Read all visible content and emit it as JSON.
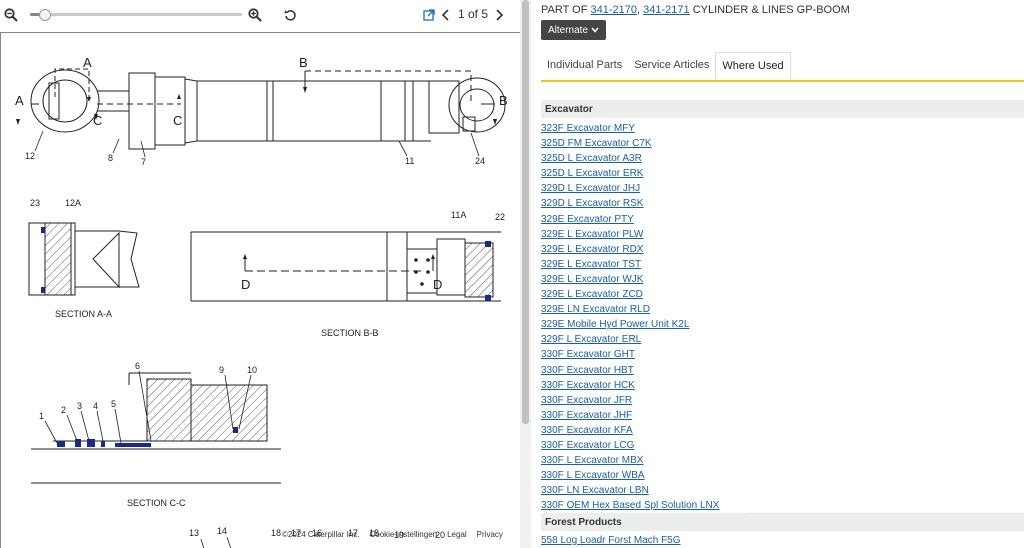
{
  "viewer": {
    "page_indicator": "1 of 5"
  },
  "drawing": {
    "labels": {
      "a": "A",
      "b": "B",
      "c": "C",
      "d": "D",
      "n12": "12",
      "n8": "8",
      "n7": "7",
      "n11": "11",
      "n24": "24",
      "n23": "23",
      "n12a": "12A",
      "n11a": "11A",
      "n22": "22",
      "n6": "6",
      "n9": "9",
      "n10": "10",
      "n1": "1",
      "n2": "2",
      "n3": "3",
      "n4": "4",
      "n5": "5",
      "n13": "13",
      "n14": "14",
      "n18": "18",
      "n17": "17",
      "n16": "16",
      "n19": "19",
      "n20": "20"
    },
    "section_aa": "SECTION A-A",
    "section_bb": "SECTION B-B",
    "section_cc": "SECTION C-C"
  },
  "footer": {
    "copyright": "©2024 Caterpillar Inc.",
    "cookie": "Cookie-instellingen",
    "legal": "Legal",
    "privacy": "Privacy"
  },
  "part_info": {
    "prefix": "PART OF",
    "link1": "341-2170",
    "sep": ",",
    "link2": "341-2171",
    "suffix": "CYLINDER & LINES GP-BOOM"
  },
  "alternate_button": "Alternate",
  "tabs": [
    "Individual Parts",
    "Service Articles",
    "Where Used"
  ],
  "sections": [
    {
      "title": "Excavator",
      "items": [
        "323F Excavator MFY",
        "325D FM Excavator C7K",
        "325D L Excavator A3R",
        "325D L Excavator ERK",
        "329D L Excavator JHJ",
        "329D L Excavator RSK",
        "329E Excavator PTY",
        "329E L Excavator PLW",
        "329E L Excavator RDX",
        "329E L Excavator TST",
        "329E L Excavator WJK",
        "329E L Excavator ZCD",
        "329E LN Excavator RLD",
        "329E Mobile Hyd Power Unit K2L",
        "329F L Excavator ERL",
        "330F Excavator GHT",
        "330F Excavator HBT",
        "330F Excavator HCK",
        "330F Excavator JFR",
        "330F Excavator JHF",
        "330F Excavator KFA",
        "330F Excavator LCG",
        "330F L Excavator MBX",
        "330F L Excavator WBA",
        "330F LN Excavator LBN",
        "330F OEM Hex Based Spl Solution LNX"
      ]
    },
    {
      "title": "Forest Products",
      "items": [
        "558 Log Loadr Forst Mach F5G"
      ]
    }
  ]
}
